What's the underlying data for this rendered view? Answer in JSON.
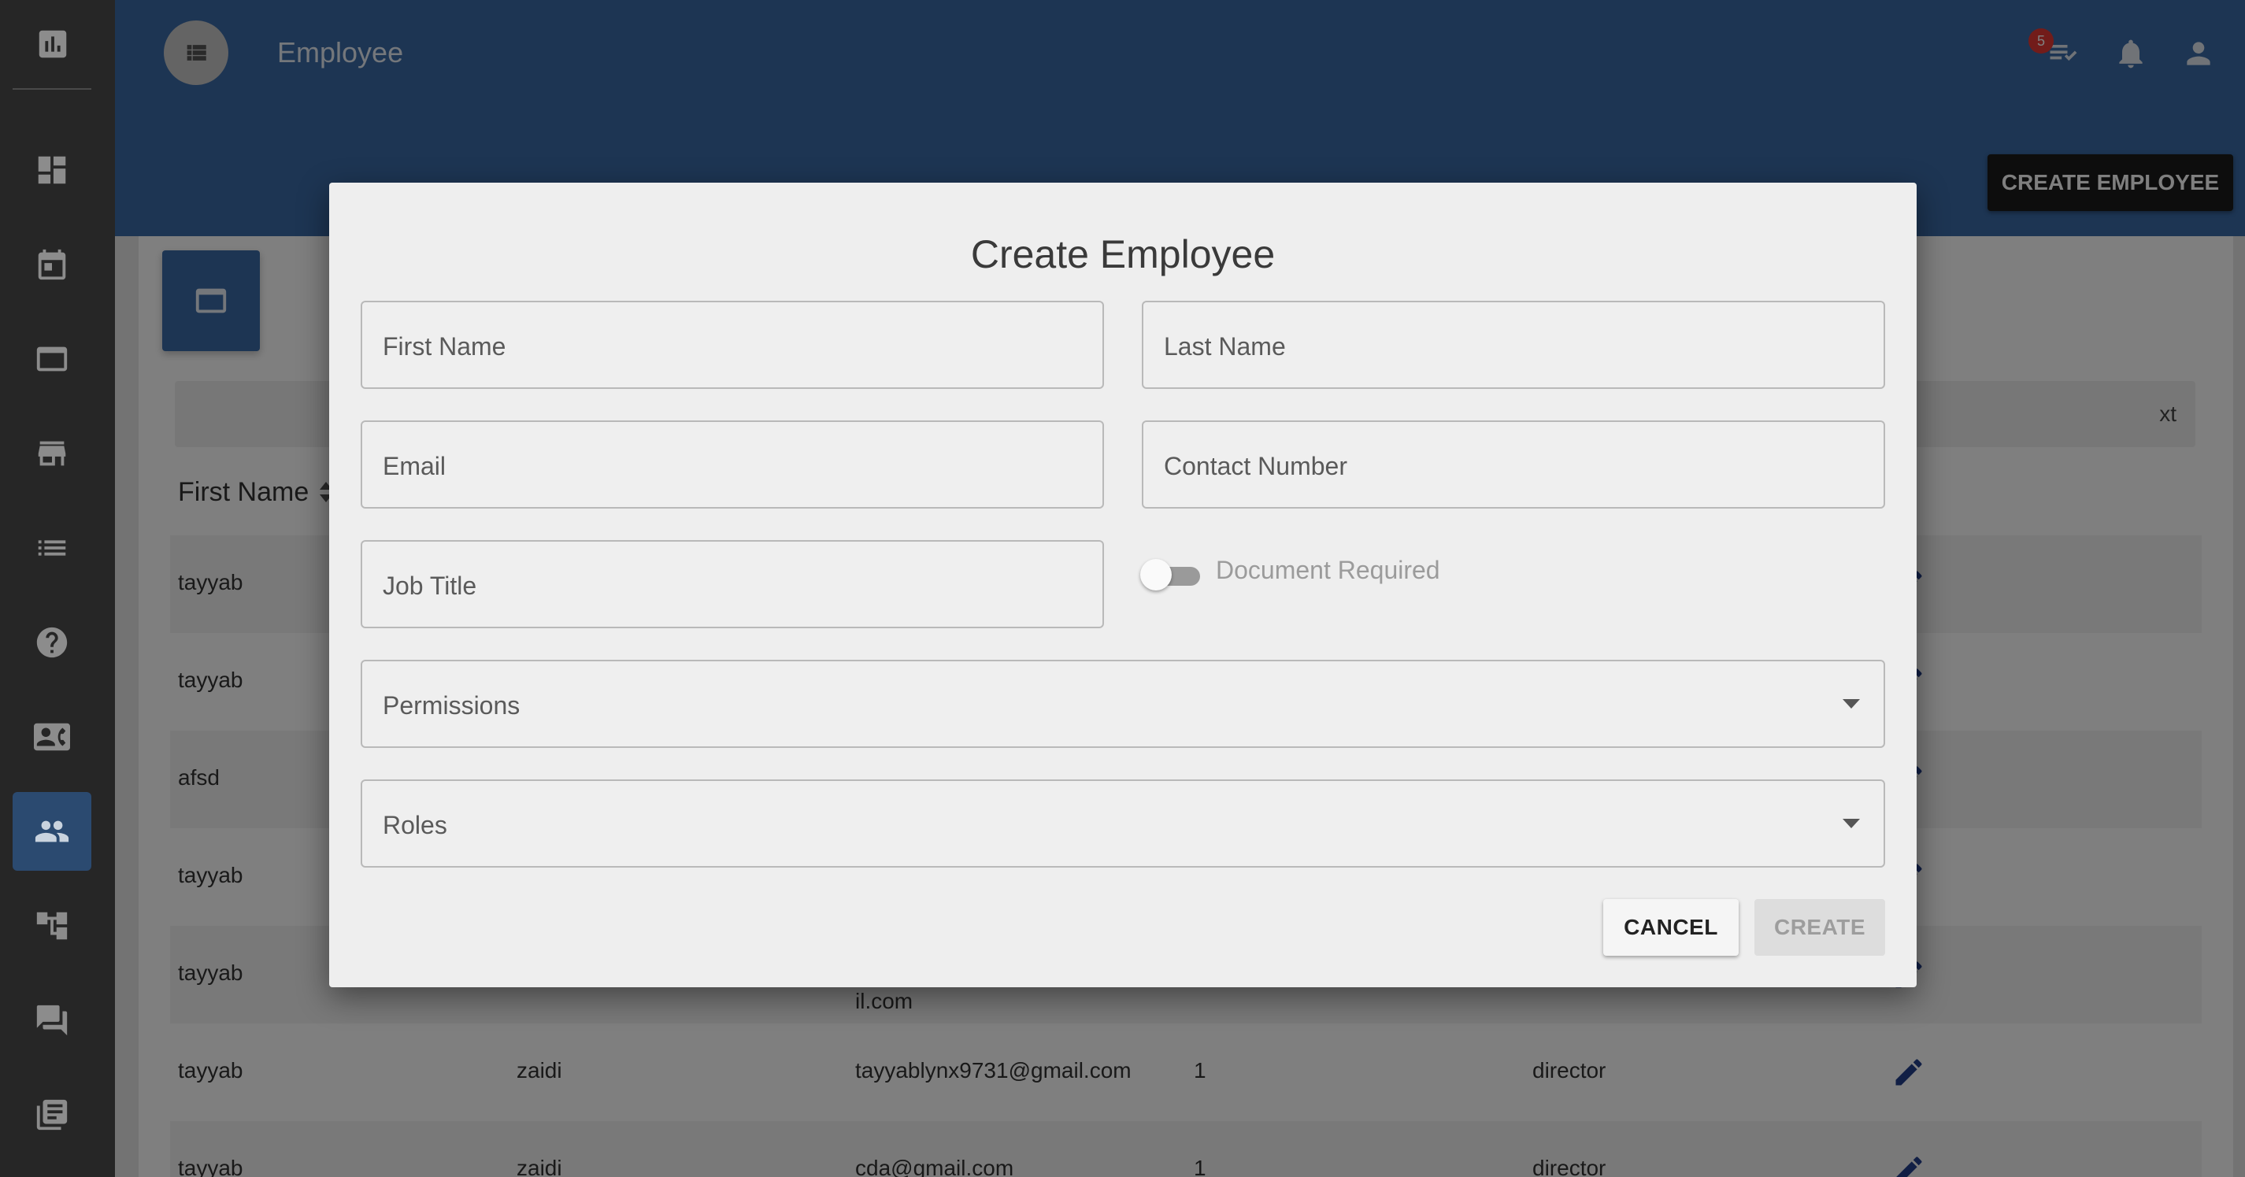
{
  "sidebar": {
    "logo_icon": "bar-chart-icon",
    "items": [
      {
        "icon": "dashboard-icon",
        "active": false
      },
      {
        "icon": "calendar-icon",
        "active": false
      },
      {
        "icon": "window-icon",
        "active": false
      },
      {
        "icon": "store-icon",
        "active": false
      },
      {
        "icon": "list-icon",
        "active": false
      },
      {
        "icon": "help-icon",
        "active": false
      },
      {
        "icon": "contact-card-icon",
        "active": false
      },
      {
        "icon": "people-icon",
        "active": true
      },
      {
        "icon": "hierarchy-icon",
        "active": false
      },
      {
        "icon": "chat-icon",
        "active": false
      },
      {
        "icon": "library-icon",
        "active": false
      }
    ]
  },
  "header": {
    "title": "Employee",
    "notification_count": "5",
    "create_button_label": "CREATE EMPLOYEE"
  },
  "table": {
    "search_partial_text": "xt",
    "first_column_header": "First Name",
    "rows": [
      {
        "first_name": "tayyab",
        "last_name": "",
        "email": "",
        "number": "",
        "role": ""
      },
      {
        "first_name": "tayyab",
        "last_name": "",
        "email": "",
        "number": "",
        "role": ""
      },
      {
        "first_name": "afsd",
        "last_name": "",
        "email": "",
        "number": "",
        "role": ""
      },
      {
        "first_name": "tayyab",
        "last_name": "",
        "email": "",
        "number": "",
        "role": ""
      },
      {
        "first_name": "tayyab",
        "last_name": "",
        "email": "il.com",
        "number": "",
        "role": ""
      },
      {
        "first_name": "tayyab",
        "last_name": "zaidi",
        "email": "tayyablynx9731@gmail.com",
        "number": "1",
        "role": "director"
      },
      {
        "first_name": "tayyab",
        "last_name": "zaidi",
        "email": "cda@gmail.com",
        "number": "1",
        "role": "director"
      }
    ]
  },
  "dialog": {
    "title": "Create Employee",
    "fields": {
      "first_name": "First Name",
      "last_name": "Last Name",
      "email": "Email",
      "contact_number": "Contact Number",
      "job_title": "Job Title",
      "permissions": "Permissions",
      "roles": "Roles"
    },
    "document_required_label": "Document Required",
    "document_required_on": false,
    "cancel_label": "CANCEL",
    "create_label": "CREATE"
  },
  "colors": {
    "sidebar": "#262626",
    "appbar": "#3a6aa6",
    "active_nav": "#2b4a70",
    "edit_icon": "#233e8b",
    "badge": "#e53935"
  }
}
